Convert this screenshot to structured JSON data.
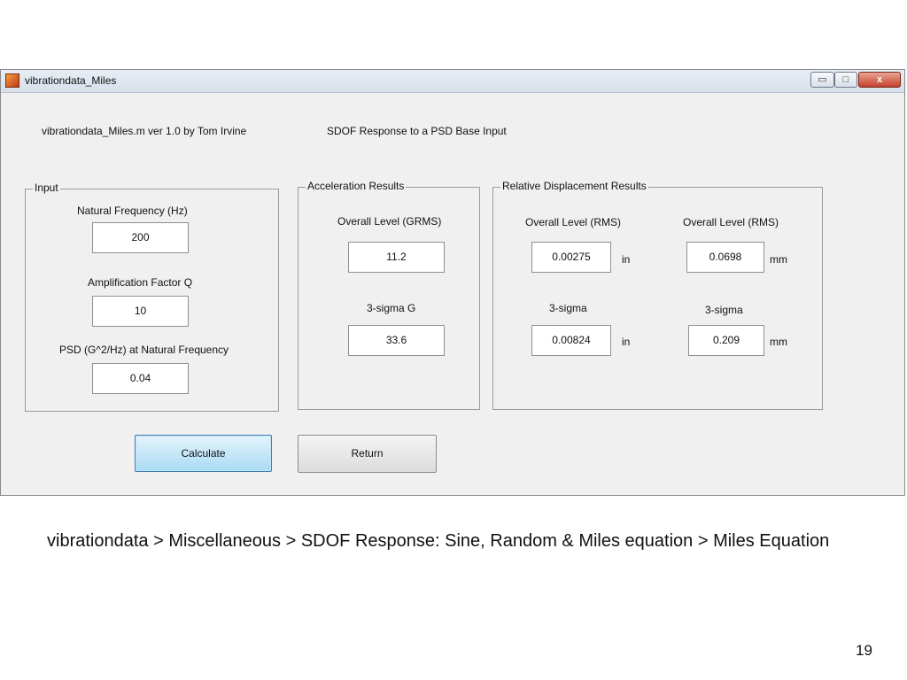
{
  "window": {
    "title": "vibrationdata_Miles",
    "controls": {
      "minimize": "▭",
      "maximize": "□",
      "close": "x"
    }
  },
  "header": {
    "program_label": "vibrationdata_Miles.m  ver 1.0  by Tom Irvine",
    "description": "SDOF Response to a PSD Base Input"
  },
  "input_group": {
    "legend": "Input",
    "natural_frequency": {
      "label": "Natural Frequency (Hz)",
      "value": "200"
    },
    "amplification_q": {
      "label": "Amplification Factor Q",
      "value": "10"
    },
    "psd": {
      "label": "PSD (G^2/Hz) at Natural Frequency",
      "value": "0.04"
    }
  },
  "acceleration_group": {
    "legend": "Acceleration Results",
    "overall": {
      "label": "Overall Level (GRMS)",
      "value": "11.2"
    },
    "sigma3": {
      "label": "3-sigma G",
      "value": "33.6"
    }
  },
  "displacement_group": {
    "legend": "Relative Displacement Results",
    "overall_in": {
      "label": "Overall Level (RMS)",
      "value": "0.00275",
      "unit": "in"
    },
    "overall_mm": {
      "label": "Overall Level (RMS)",
      "value": "0.0698",
      "unit": "mm"
    },
    "sigma3_in": {
      "label": "3-sigma",
      "value": "0.00824",
      "unit": "in"
    },
    "sigma3_mm": {
      "label": "3-sigma",
      "value": "0.209",
      "unit": "mm"
    }
  },
  "buttons": {
    "calculate": "Calculate",
    "return": "Return"
  },
  "slide": {
    "caption": "vibrationdata > Miscellaneous > SDOF Response: Sine, Random & Miles equation > Miles Equation",
    "page_number": "19"
  }
}
